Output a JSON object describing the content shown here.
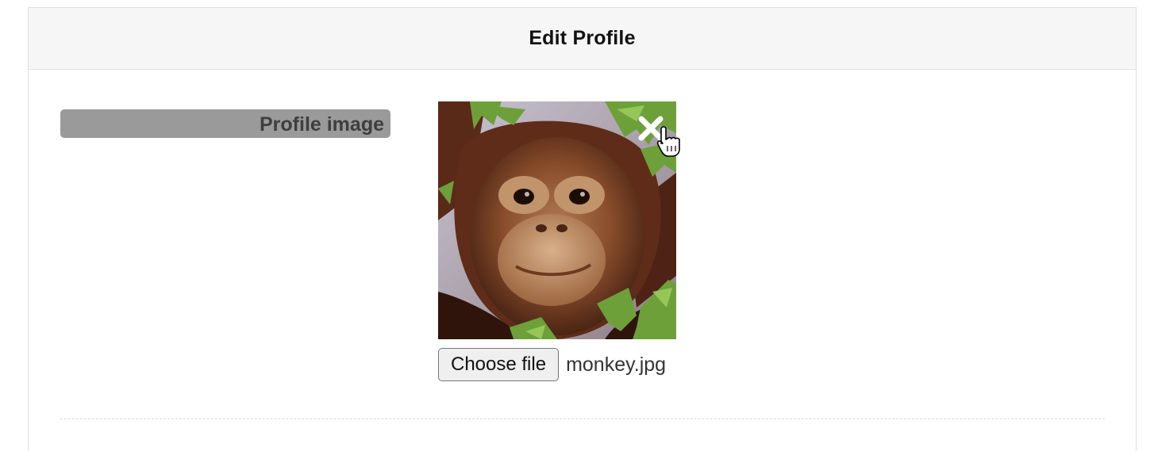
{
  "panel": {
    "title": "Edit Profile"
  },
  "profile_image": {
    "label": "Profile image",
    "preview_image": "orangutan-photo",
    "remove_icon": "close-icon",
    "file_button_label": "Choose file",
    "file_name": "monkey.jpg"
  },
  "cursor_icon": "hand-pointer-icon"
}
